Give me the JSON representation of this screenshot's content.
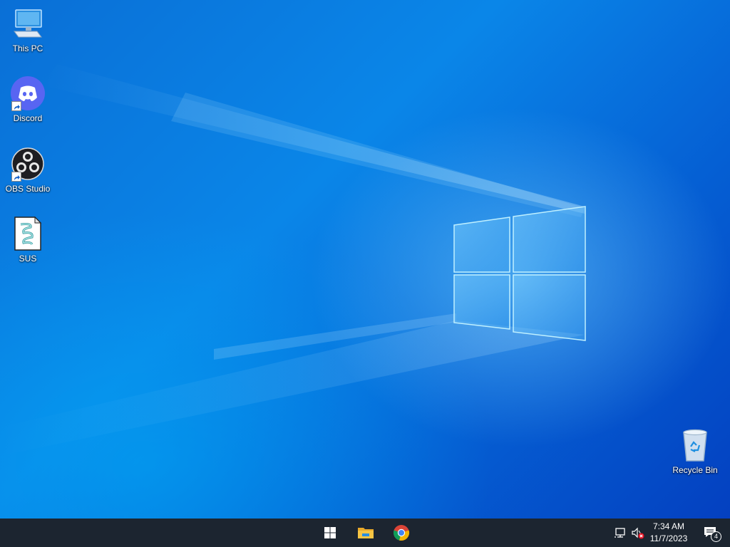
{
  "desktop": {
    "icons": [
      {
        "label": "This PC",
        "icon": "computer-icon"
      },
      {
        "label": "Discord",
        "icon": "discord-icon"
      },
      {
        "label": "OBS Studio",
        "icon": "obs-studio-icon"
      },
      {
        "label": "SUS",
        "icon": "script-file-icon"
      },
      {
        "label": "Recycle Bin",
        "icon": "recycle-bin-icon"
      }
    ]
  },
  "taskbar": {
    "pinned": [
      {
        "icon": "windows-start-icon"
      },
      {
        "icon": "file-explorer-icon"
      },
      {
        "icon": "chrome-icon"
      }
    ],
    "tray": {
      "network_icon": "network-icon",
      "volume_icon": "volume-muted-icon",
      "time": "7:34 AM",
      "date": "11/7/2023",
      "notification_count": "4"
    }
  },
  "colors": {
    "taskbar": "#1c2530",
    "desktop_accent": "#0a86e8",
    "discord": "#5865f2"
  }
}
